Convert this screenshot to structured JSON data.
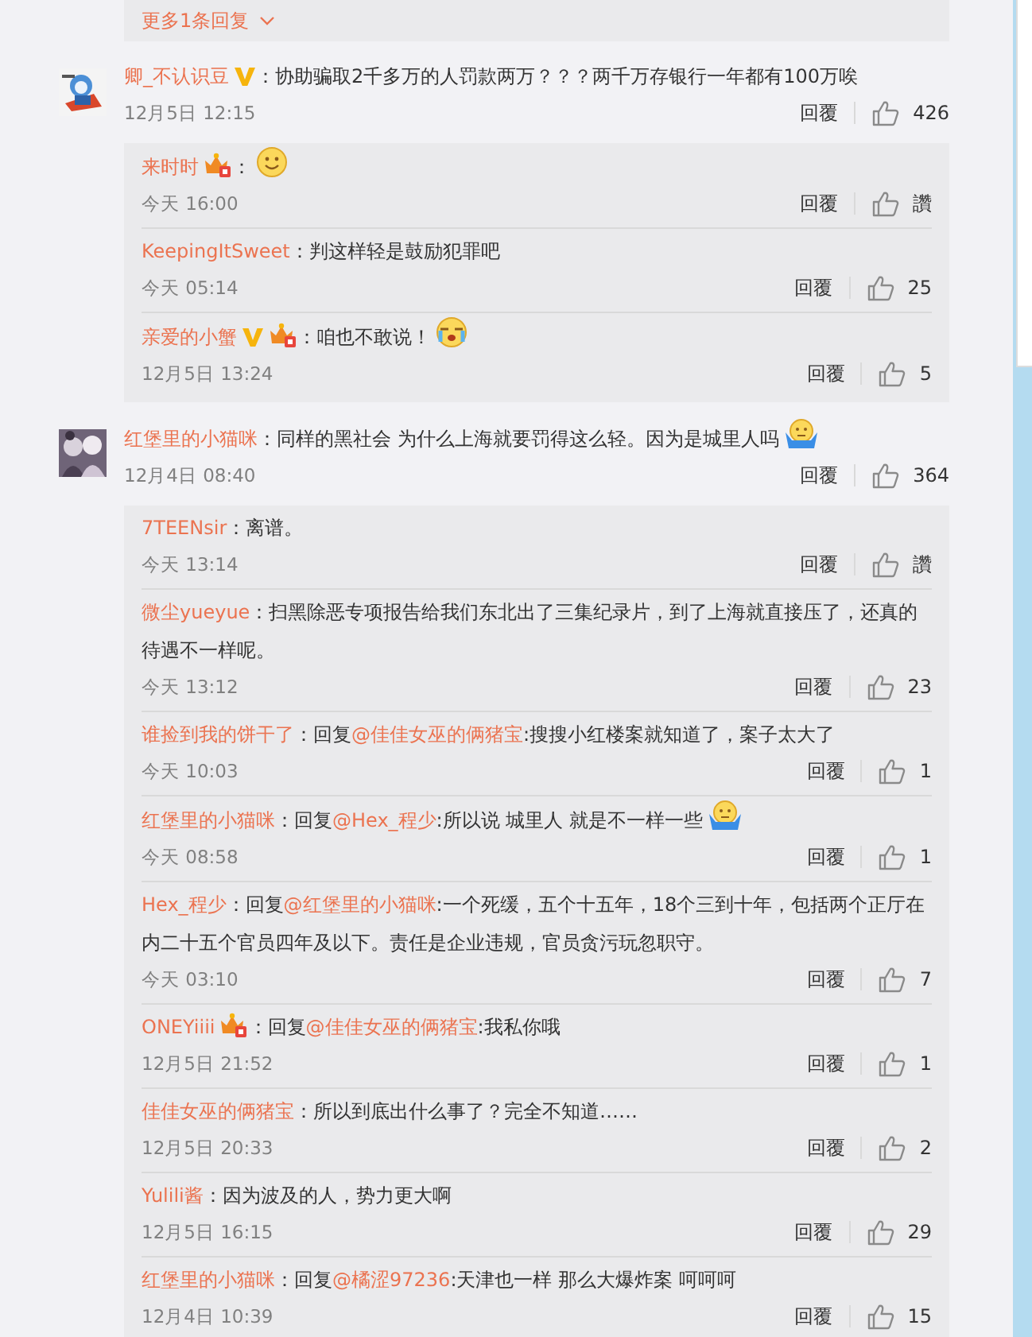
{
  "more_replies": {
    "label": "更多1条回复"
  },
  "comments": [
    {
      "avatar": {
        "kind": "picture"
      },
      "user": "卿_不认识豆",
      "verified": true,
      "body": [
        {
          "kind": "plain",
          "text": "：协助骗取2千多万的人罚款两万？？？两千万存银行一年都有100万唉"
        }
      ],
      "time": "12月5日 12:15",
      "reply_label": "回覆",
      "likes": "426",
      "replies": [
        {
          "user": "来时时",
          "vip": true,
          "body": [
            {
              "kind": "plain",
              "text": "："
            }
          ],
          "end_icon": {
            "kind": "smile"
          },
          "time": "今天 16:00",
          "reply_label": "回覆",
          "likes": "讚"
        },
        {
          "user": "KeepingItSweet",
          "body": [
            {
              "kind": "plain",
              "text": "：判这样轻是鼓励犯罪吧"
            }
          ],
          "time": "今天 05:14",
          "reply_label": "回覆",
          "likes": "25"
        },
        {
          "user": "亲爱的小蟹",
          "verified": true,
          "vip": true,
          "body": [
            {
              "kind": "plain",
              "text": "：咱也不敢说！"
            }
          ],
          "end_icon": {
            "kind": "cry"
          },
          "time": "12月5日 13:24",
          "reply_label": "回覆",
          "likes": "5"
        }
      ]
    },
    {
      "avatar": {
        "kind": "picture"
      },
      "user": "红堡里的小猫咪",
      "body": [
        {
          "kind": "plain",
          "text": "：同样的黑社会 为什么上海就要罚得这么轻。因为是城里人吗"
        }
      ],
      "end_icon": {
        "kind": "shrug"
      },
      "time": "12月4日 08:40",
      "reply_label": "回覆",
      "likes": "364",
      "replies": [
        {
          "user": "7TEENsir",
          "body": [
            {
              "kind": "plain",
              "text": "：离谱。"
            }
          ],
          "time": "今天 13:14",
          "reply_label": "回覆",
          "likes": "讚"
        },
        {
          "user": "微尘yueyue",
          "body": [
            {
              "kind": "plain",
              "text": "：扫黑除恶专项报告给我们东北出了三集纪录片，到了上海就直接压了，还真的待遇不一样呢。"
            }
          ],
          "time": "今天 13:12",
          "reply_label": "回覆",
          "likes": "23"
        },
        {
          "user": "谁捡到我的饼干了",
          "body": [
            {
              "kind": "plain",
              "text": "：回复"
            },
            {
              "kind": "mention",
              "text": "@佳佳女巫的俩猪宝"
            },
            {
              "kind": "plain",
              "text": ":搜搜小红楼案就知道了，案子太大了"
            }
          ],
          "time": "今天 10:03",
          "reply_label": "回覆",
          "likes": "1"
        },
        {
          "user": "红堡里的小猫咪",
          "body": [
            {
              "kind": "plain",
              "text": "：回复"
            },
            {
              "kind": "mention",
              "text": "@Hex_程少"
            },
            {
              "kind": "plain",
              "text": ":所以说 城里人 就是不一样一些"
            }
          ],
          "end_icon": {
            "kind": "shrug"
          },
          "time": "今天 08:58",
          "reply_label": "回覆",
          "likes": "1"
        },
        {
          "user": "Hex_程少",
          "body": [
            {
              "kind": "plain",
              "text": "：回复"
            },
            {
              "kind": "mention",
              "text": "@红堡里的小猫咪"
            },
            {
              "kind": "plain",
              "text": ":一个死缓，五个十五年，18个三到十年，包括两个正厅在内二十五个官员四年及以下。责任是企业违规，官员贪污玩忽职守。"
            }
          ],
          "time": "今天 03:10",
          "reply_label": "回覆",
          "likes": "7"
        },
        {
          "user": "ONEYiiii",
          "vip": true,
          "body": [
            {
              "kind": "plain",
              "text": "：回复"
            },
            {
              "kind": "mention",
              "text": "@佳佳女巫的俩猪宝"
            },
            {
              "kind": "plain",
              "text": ":我私你哦"
            }
          ],
          "time": "12月5日 21:52",
          "reply_label": "回覆",
          "likes": "1"
        },
        {
          "user": "佳佳女巫的俩猪宝",
          "body": [
            {
              "kind": "plain",
              "text": "：所以到底出什么事了？完全不知道……"
            }
          ],
          "time": "12月5日 20:33",
          "reply_label": "回覆",
          "likes": "2"
        },
        {
          "user": "Yulili酱",
          "body": [
            {
              "kind": "plain",
              "text": "：因为波及的人，势力更大啊"
            }
          ],
          "time": "12月5日 16:15",
          "reply_label": "回覆",
          "likes": "29"
        },
        {
          "user": "红堡里的小猫咪",
          "body": [
            {
              "kind": "plain",
              "text": "：回复"
            },
            {
              "kind": "mention",
              "text": "@橘涩97236"
            },
            {
              "kind": "plain",
              "text": ":天津也一样 那么大爆炸案 呵呵呵"
            }
          ],
          "time": "12月4日 10:39",
          "reply_label": "回覆",
          "likes": "15"
        }
      ]
    }
  ]
}
